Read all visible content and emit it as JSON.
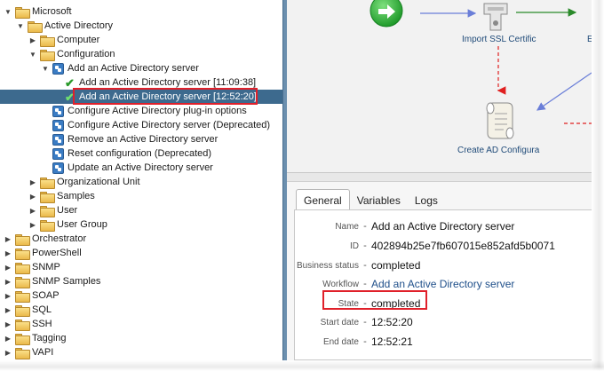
{
  "tree": {
    "rows": [
      {
        "label": "Microsoft",
        "kind": "folder",
        "toggle": "▼",
        "indent": 1
      },
      {
        "label": "Active Directory",
        "kind": "folder",
        "toggle": "▼",
        "indent": 2
      },
      {
        "label": "Computer",
        "kind": "folder",
        "toggle": "▶",
        "indent": 3
      },
      {
        "label": "Configuration",
        "kind": "folder",
        "toggle": "▼",
        "indent": 3
      },
      {
        "label": "Add an Active Directory server",
        "kind": "workflow",
        "toggle": "▼",
        "indent": 4
      },
      {
        "label": "Add an Active Directory server [11:09:38]",
        "kind": "run",
        "toggle": "",
        "indent": 5
      },
      {
        "label": "Add an Active Directory server [12:52:20]",
        "kind": "run",
        "toggle": "",
        "indent": 5,
        "selected": true
      },
      {
        "label": "Configure Active Directory plug-in options",
        "kind": "workflow",
        "toggle": "",
        "indent": 4
      },
      {
        "label": "Configure Active Directory server (Deprecated)",
        "kind": "workflow",
        "toggle": "",
        "indent": 4
      },
      {
        "label": "Remove an Active Directory server",
        "kind": "workflow",
        "toggle": "",
        "indent": 4
      },
      {
        "label": "Reset configuration (Deprecated)",
        "kind": "workflow",
        "toggle": "",
        "indent": 4
      },
      {
        "label": "Update an Active Directory server",
        "kind": "workflow",
        "toggle": "",
        "indent": 4
      },
      {
        "label": "Organizational Unit",
        "kind": "folder",
        "toggle": "▶",
        "indent": 3
      },
      {
        "label": "Samples",
        "kind": "folder",
        "toggle": "▶",
        "indent": 3
      },
      {
        "label": "User",
        "kind": "folder",
        "toggle": "▶",
        "indent": 3
      },
      {
        "label": "User Group",
        "kind": "folder",
        "toggle": "▶",
        "indent": 3
      },
      {
        "label": "Orchestrator",
        "kind": "folder",
        "toggle": "▶",
        "indent": 1
      },
      {
        "label": "PowerShell",
        "kind": "folder",
        "toggle": "▶",
        "indent": 1
      },
      {
        "label": "SNMP",
        "kind": "folder",
        "toggle": "▶",
        "indent": 1
      },
      {
        "label": "SNMP Samples",
        "kind": "folder",
        "toggle": "▶",
        "indent": 1
      },
      {
        "label": "SOAP",
        "kind": "folder",
        "toggle": "▶",
        "indent": 1
      },
      {
        "label": "SQL",
        "kind": "folder",
        "toggle": "▶",
        "indent": 1
      },
      {
        "label": "SSH",
        "kind": "folder",
        "toggle": "▶",
        "indent": 1
      },
      {
        "label": "Tagging",
        "kind": "folder",
        "toggle": "▶",
        "indent": 1
      },
      {
        "label": "VAPI",
        "kind": "folder",
        "toggle": "▶",
        "indent": 1
      }
    ]
  },
  "canvas": {
    "import_ssl_label": "Import SSL Certific",
    "create_ad_label": "Create AD Configura",
    "edge_label": "E"
  },
  "tabs": [
    {
      "label": "General",
      "active": true
    },
    {
      "label": "Variables",
      "active": false
    },
    {
      "label": "Logs",
      "active": false
    }
  ],
  "properties": {
    "name_label": "Name",
    "name_value": "Add an Active Directory server",
    "id_label": "ID",
    "id_value": "402894b25e7fb607015e852afd5b0071",
    "business_status_label": "Business status",
    "business_status_value": "completed",
    "workflow_label": "Workflow",
    "workflow_value": "Add an Active Directory server",
    "state_label": "State",
    "state_value": "completed",
    "start_date_label": "Start date",
    "start_date_value": "12:52:20",
    "end_date_label": "End date",
    "end_date_value": "12:52:21",
    "dash": "-"
  },
  "colors": {
    "selection": "#3d6a8e",
    "highlight_box": "#e0202a",
    "link": "#1f4f8a",
    "success": "#2a9a2a"
  }
}
